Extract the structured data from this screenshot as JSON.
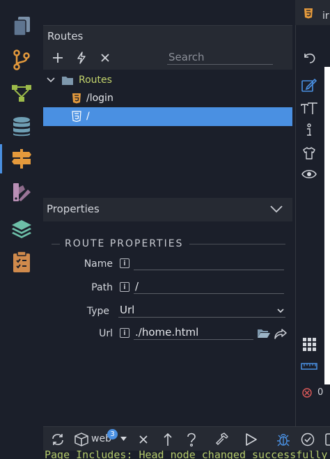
{
  "routes_panel": {
    "title": "Routes",
    "search_placeholder": "Search",
    "tree": [
      {
        "label": "Routes",
        "type": "folder",
        "color": "#c3d46c"
      },
      {
        "label": "/login",
        "type": "html"
      },
      {
        "label": "/",
        "type": "html",
        "selected": true
      }
    ]
  },
  "properties_panel": {
    "title": "Properties",
    "section_title": "ROUTE PROPERTIES",
    "fields": {
      "name_label": "Name",
      "name_value": "",
      "path_label": "Path",
      "path_value": "/",
      "type_label": "Type",
      "type_value": "Url",
      "url_label": "Url",
      "url_value": "./home.html"
    },
    "info_glyph": "i"
  },
  "right_strip": {
    "tab_label": "ir",
    "error_count": "0"
  },
  "bottom_bar": {
    "target_label": "web",
    "target_badge": "3"
  },
  "status_bar": {
    "message": "Page Includes: Head node changed successfully"
  },
  "colors": {
    "accent": "#4a90e2",
    "folder_text": "#c3d46c",
    "html_icon": "#e59a3c",
    "status_text": "#b3c96a"
  }
}
